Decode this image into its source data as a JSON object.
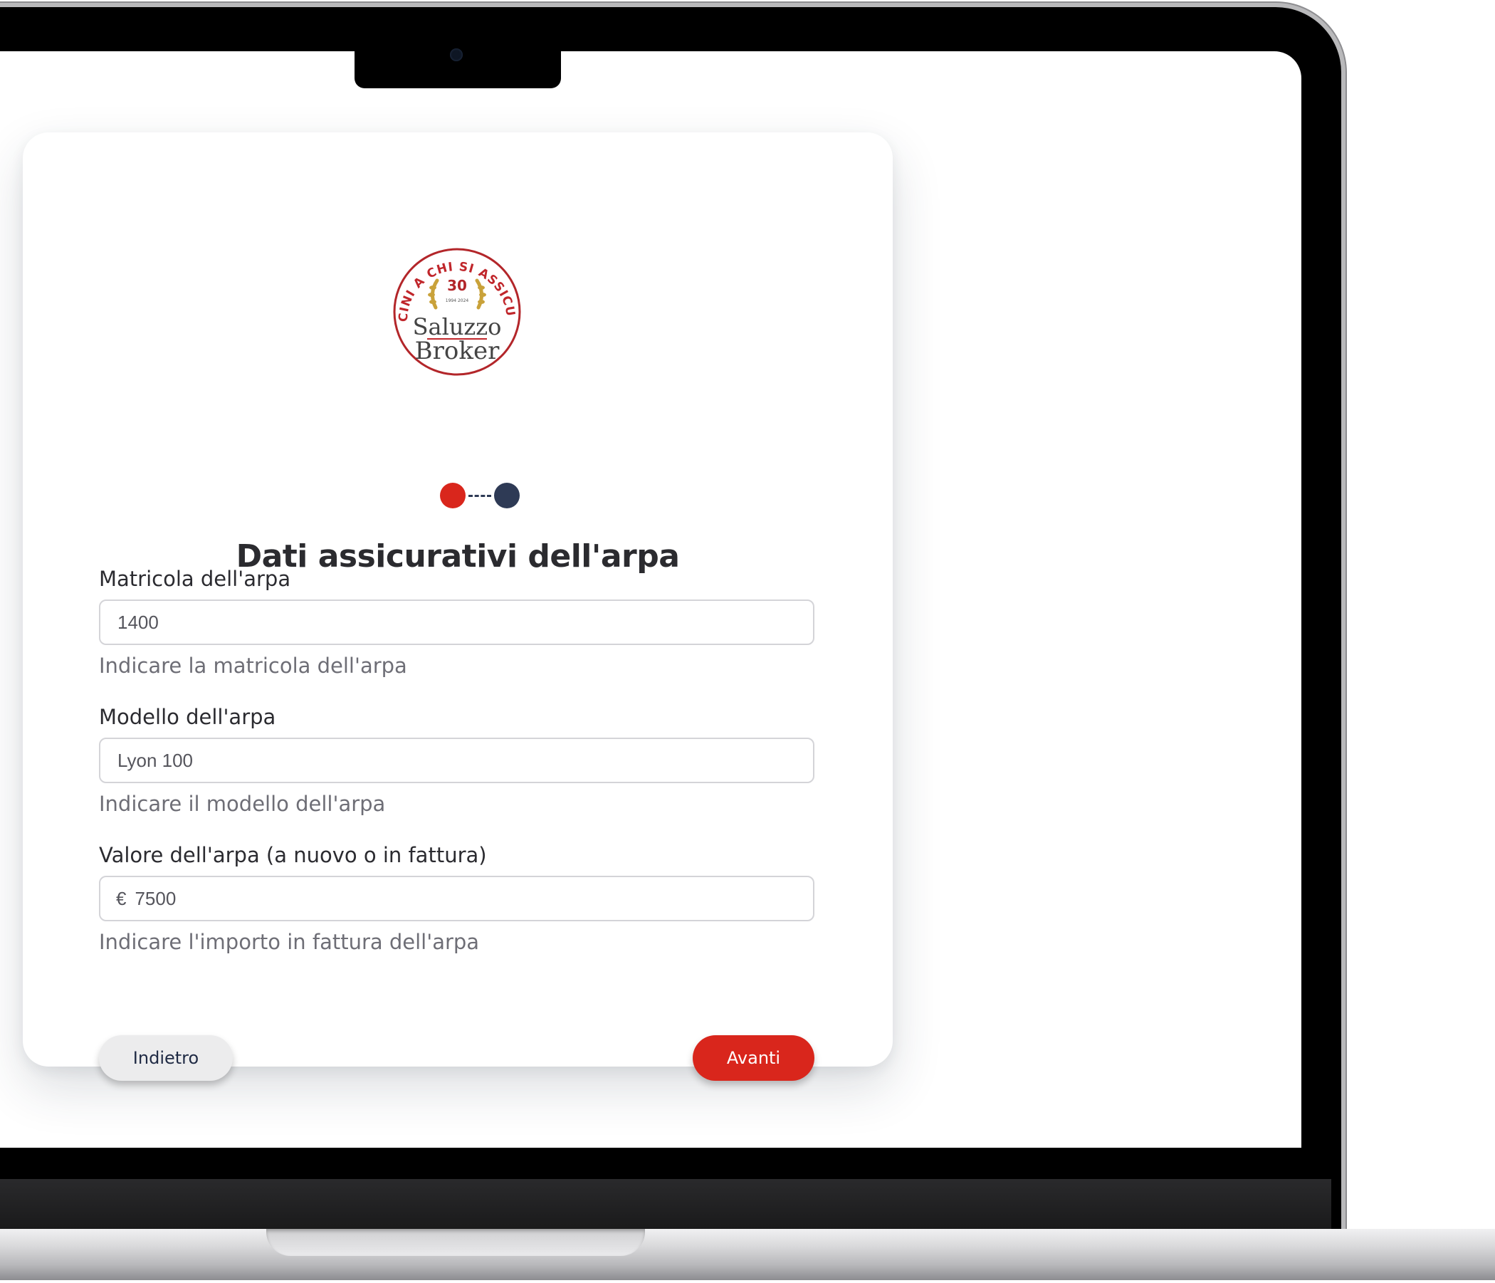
{
  "brand": {
    "seal_text_top": "VICINI A CHI SI ASSICURA",
    "seal_anniversary": "30",
    "seal_years": "1994 2024",
    "name_line1": "Saluzzo",
    "name_line2": "Broker",
    "accent_color": "#d9261c",
    "gold_color": "#c9a23a"
  },
  "stepper": {
    "current_step": 1,
    "total_steps": 2,
    "active_color": "#d9261c",
    "pending_color": "#2e3a55"
  },
  "form": {
    "title": "Dati assicurativi dell'arpa",
    "fields": [
      {
        "label": "Matricola dell'arpa",
        "value": "1400",
        "help": "Indicare la matricola dell'arpa"
      },
      {
        "label": "Modello dell'arpa",
        "value": "Lyon 100",
        "help": "Indicare il modello dell'arpa"
      },
      {
        "label": "Valore dell'arpa (a nuovo o in fattura)",
        "prefix": "€",
        "value": "7500",
        "help": "Indicare l'importo in fattura dell'arpa"
      }
    ]
  },
  "actions": {
    "back_label": "Indietro",
    "next_label": "Avanti"
  }
}
